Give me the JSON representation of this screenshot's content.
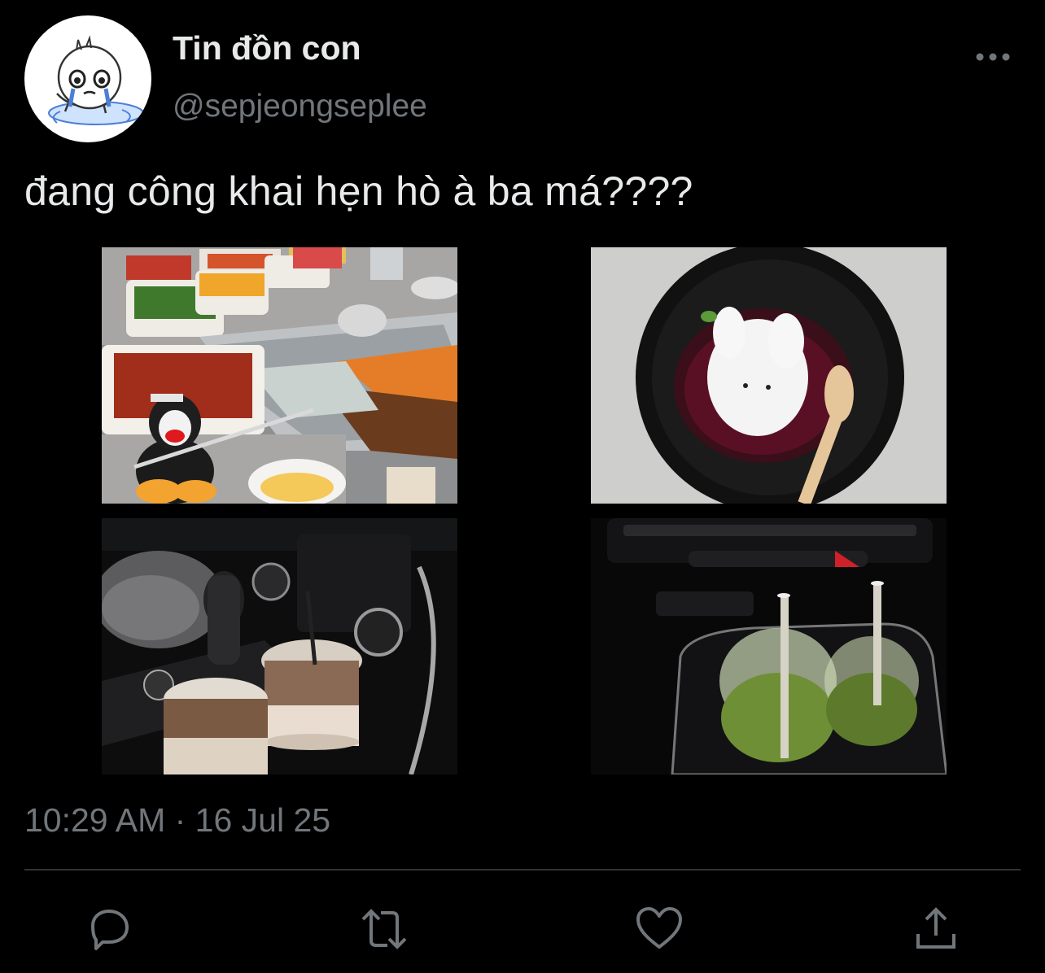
{
  "author": {
    "display_name": "Tin đồn con",
    "handle": "@sepjeongseplee",
    "avatar_icon": "crying-cartoon-avatar"
  },
  "tweet": {
    "text": "đang công khai hẹn hò à ba má????",
    "timestamp": "10:29 AM · 16 Jul 25",
    "media": [
      {
        "name": "hotpot-table-with-penguin-plush"
      },
      {
        "name": "bunny-panna-cotta-dessert"
      },
      {
        "name": "coffee-cups-in-car-console"
      },
      {
        "name": "matcha-drinks-in-car-console"
      }
    ]
  },
  "actions": {
    "reply_icon": "reply-icon",
    "retweet_icon": "retweet-icon",
    "like_icon": "heart-icon",
    "share_icon": "share-icon",
    "more_icon": "more-dots-icon"
  },
  "colors": {
    "background": "#000000",
    "primary_text": "#e7e9ea",
    "secondary_text": "#71767b",
    "divider": "#2f3336"
  }
}
